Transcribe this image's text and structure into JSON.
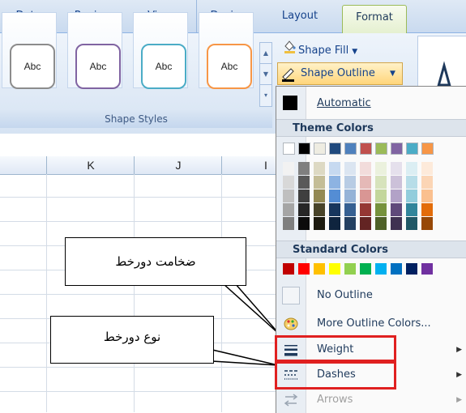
{
  "tabs": [
    {
      "id": "data",
      "label": "Data"
    },
    {
      "id": "review",
      "label": "Review"
    },
    {
      "id": "view",
      "label": "View"
    },
    {
      "id": "design",
      "label": "Design"
    },
    {
      "id": "layout",
      "label": "Layout"
    },
    {
      "id": "format",
      "label": "Format"
    }
  ],
  "ribbon": {
    "shape_style_sample_text": "Abc",
    "shape_styles_group_label": "Shape Styles",
    "shape_fill_label": "Shape Fill",
    "shape_outline_label": "Shape Outline",
    "shape_style_border_colors": [
      "#8c8c8c",
      "#8064a2",
      "#4bacc6",
      "#f79646"
    ]
  },
  "sheet": {
    "columns": [
      "K",
      "J",
      "I"
    ]
  },
  "callouts": {
    "weight_caption": "ضخامت دورخط",
    "dashes_caption": "نوع دورخط"
  },
  "menu": {
    "automatic_label": "Automatic",
    "theme_colors_header": "Theme Colors",
    "standard_colors_header": "Standard Colors",
    "no_outline_label": "No Outline",
    "more_outline_colors_label": "More Outline Colors...",
    "weight_label": "Weight",
    "dashes_label": "Dashes",
    "arrows_label": "Arrows",
    "theme_top_row": [
      "#ffffff",
      "#000000",
      "#eeece1",
      "#1f497d",
      "#4f81bd",
      "#c0504d",
      "#9bbb59",
      "#8064a2",
      "#4bacc6",
      "#f79646"
    ],
    "theme_shades": [
      [
        "#f2f2f2",
        "#d8d8d8",
        "#bfbfbf",
        "#a5a5a5",
        "#7f7f7f"
      ],
      [
        "#7f7f7f",
        "#595959",
        "#3f3f3f",
        "#262626",
        "#0c0c0c"
      ],
      [
        "#ddd9c3",
        "#c4bd97",
        "#938953",
        "#494429",
        "#1d1b10"
      ],
      [
        "#c6d9f0",
        "#8db3e2",
        "#548dd4",
        "#17365d",
        "#0f243e"
      ],
      [
        "#dbe5f1",
        "#b8cce4",
        "#95b3d7",
        "#366092",
        "#244061"
      ],
      [
        "#f2dcdb",
        "#e5b9b7",
        "#d99694",
        "#953734",
        "#632423"
      ],
      [
        "#ebf1dd",
        "#d7e3bc",
        "#c3d69b",
        "#76923c",
        "#4f6128"
      ],
      [
        "#e5e0ec",
        "#ccc1d9",
        "#b2a2c7",
        "#5f497a",
        "#3f3151"
      ],
      [
        "#dbeef3",
        "#b7dde8",
        "#92cddc",
        "#31859b",
        "#205867"
      ],
      [
        "#fdeada",
        "#fbd5b5",
        "#fac08f",
        "#e36c09",
        "#974806"
      ]
    ],
    "standard_colors": [
      "#c00000",
      "#ff0000",
      "#ffc000",
      "#ffff00",
      "#92d050",
      "#00b050",
      "#00b0f0",
      "#0070c0",
      "#002060",
      "#7030a0"
    ]
  }
}
